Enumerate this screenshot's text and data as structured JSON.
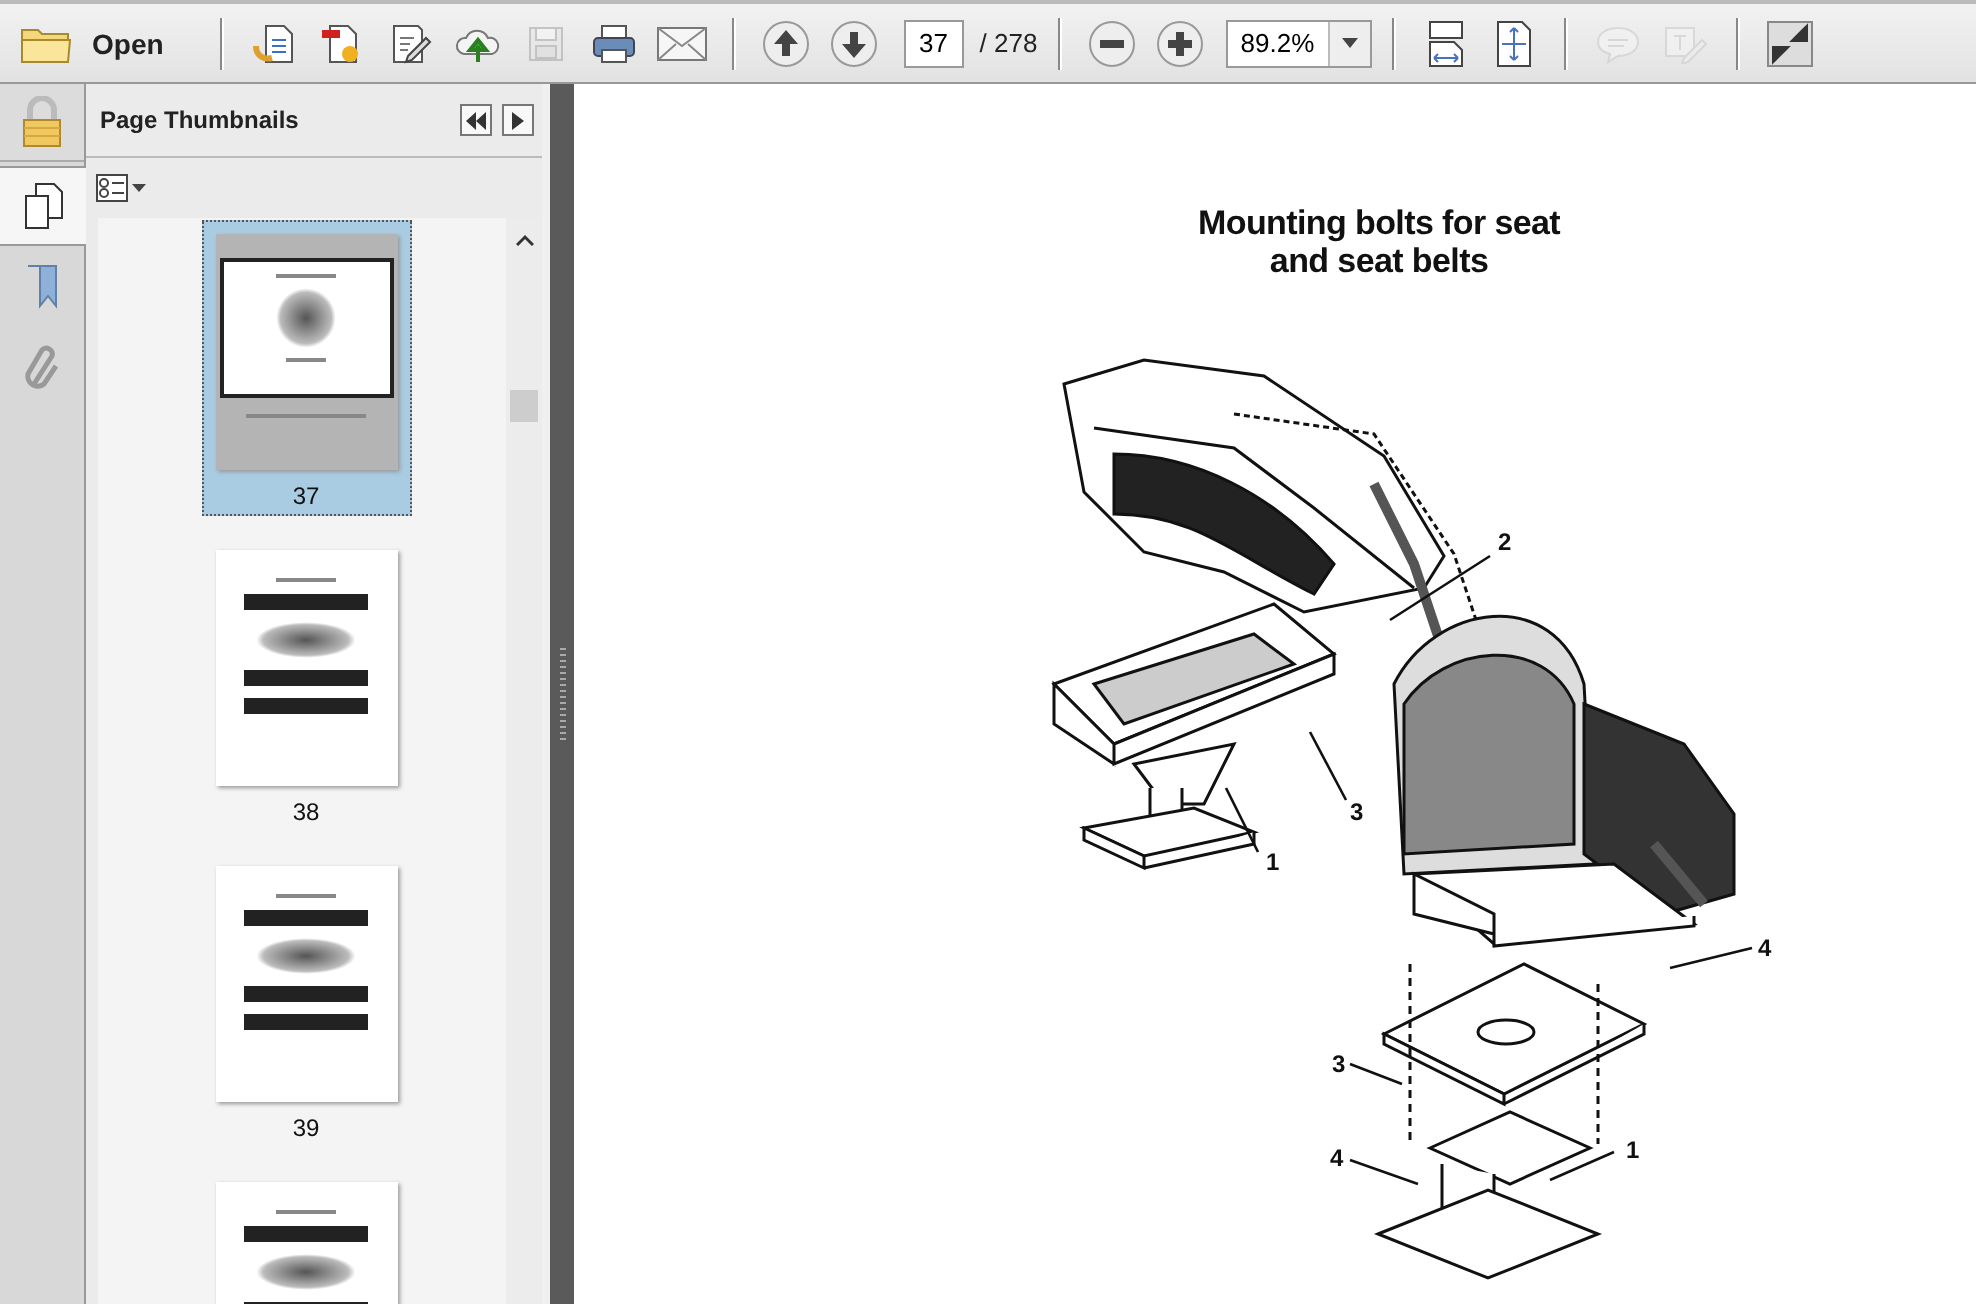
{
  "toolbar": {
    "open_label": "Open",
    "page_number": "37",
    "page_total": "/ 278",
    "zoom": "89.2%"
  },
  "sidebar": {
    "title": "Page Thumbnails",
    "thumbnails": [
      {
        "label": "37",
        "selected": true
      },
      {
        "label": "38",
        "selected": false
      },
      {
        "label": "39",
        "selected": false
      },
      {
        "selected": false
      }
    ]
  },
  "document": {
    "title_lines": [
      "Mounting bolts for seat",
      "and seat belts"
    ],
    "callouts": [
      {
        "text": "2"
      },
      {
        "text": "3"
      },
      {
        "text": "1"
      },
      {
        "text": "4"
      },
      {
        "text": "3"
      },
      {
        "text": "4"
      },
      {
        "text": "1"
      }
    ]
  }
}
